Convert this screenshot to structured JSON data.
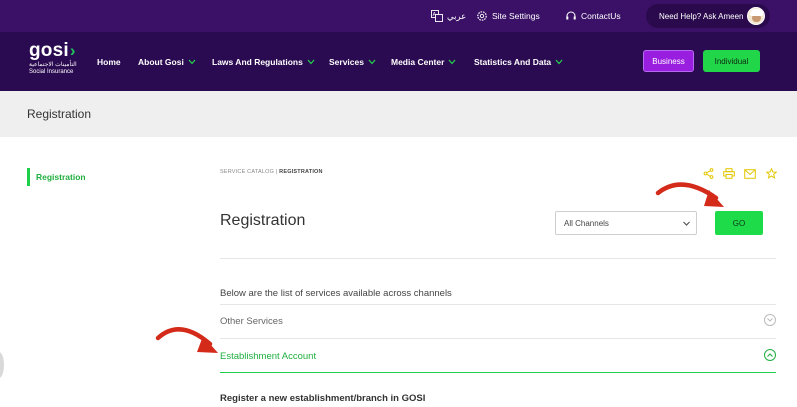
{
  "topbar": {
    "lang_label": "عربي",
    "site_settings": "Site Settings",
    "contact_us": "ContactUs",
    "help": "Need Help? Ask Ameen"
  },
  "logo": {
    "word": "gosi",
    "arabic": "التأمينات الاجتماعية",
    "english": "Social Insurance"
  },
  "nav": {
    "items": [
      {
        "label": "Home",
        "has_menu": false
      },
      {
        "label": "About Gosi",
        "has_menu": true
      },
      {
        "label": "Laws And Regulations",
        "has_menu": true
      },
      {
        "label": "Services",
        "has_menu": true
      },
      {
        "label": "Media Center",
        "has_menu": true
      },
      {
        "label": "Statistics And Data",
        "has_menu": true
      }
    ],
    "business_label": "Business",
    "individual_label": "Individual"
  },
  "page_band": {
    "title": "Registration"
  },
  "sidebar": {
    "items": [
      {
        "label": "Registration",
        "active": true
      }
    ]
  },
  "breadcrumb": {
    "parent": "SERVICE CATALOG",
    "separator": "|",
    "current": "REGISTRATION"
  },
  "share": {
    "icons": [
      "share-icon",
      "print-icon",
      "mail-icon",
      "star-icon"
    ]
  },
  "main": {
    "title": "Registration",
    "channel_select": {
      "value": "All Channels"
    },
    "go_label": "GO",
    "list_intro": "Below are the list of services available across channels",
    "accordion": [
      {
        "label": "Other Services",
        "expanded": false
      },
      {
        "label": "Establishment Account",
        "expanded": true
      }
    ],
    "description": "Register a new establishment/branch in GOSI"
  },
  "colors": {
    "topbar": "#3a1166",
    "navbar": "#2a0a50",
    "accent_green": "#1edb4a",
    "business_purple": "#9a1ee0",
    "annotation_red": "#d42a1a"
  }
}
